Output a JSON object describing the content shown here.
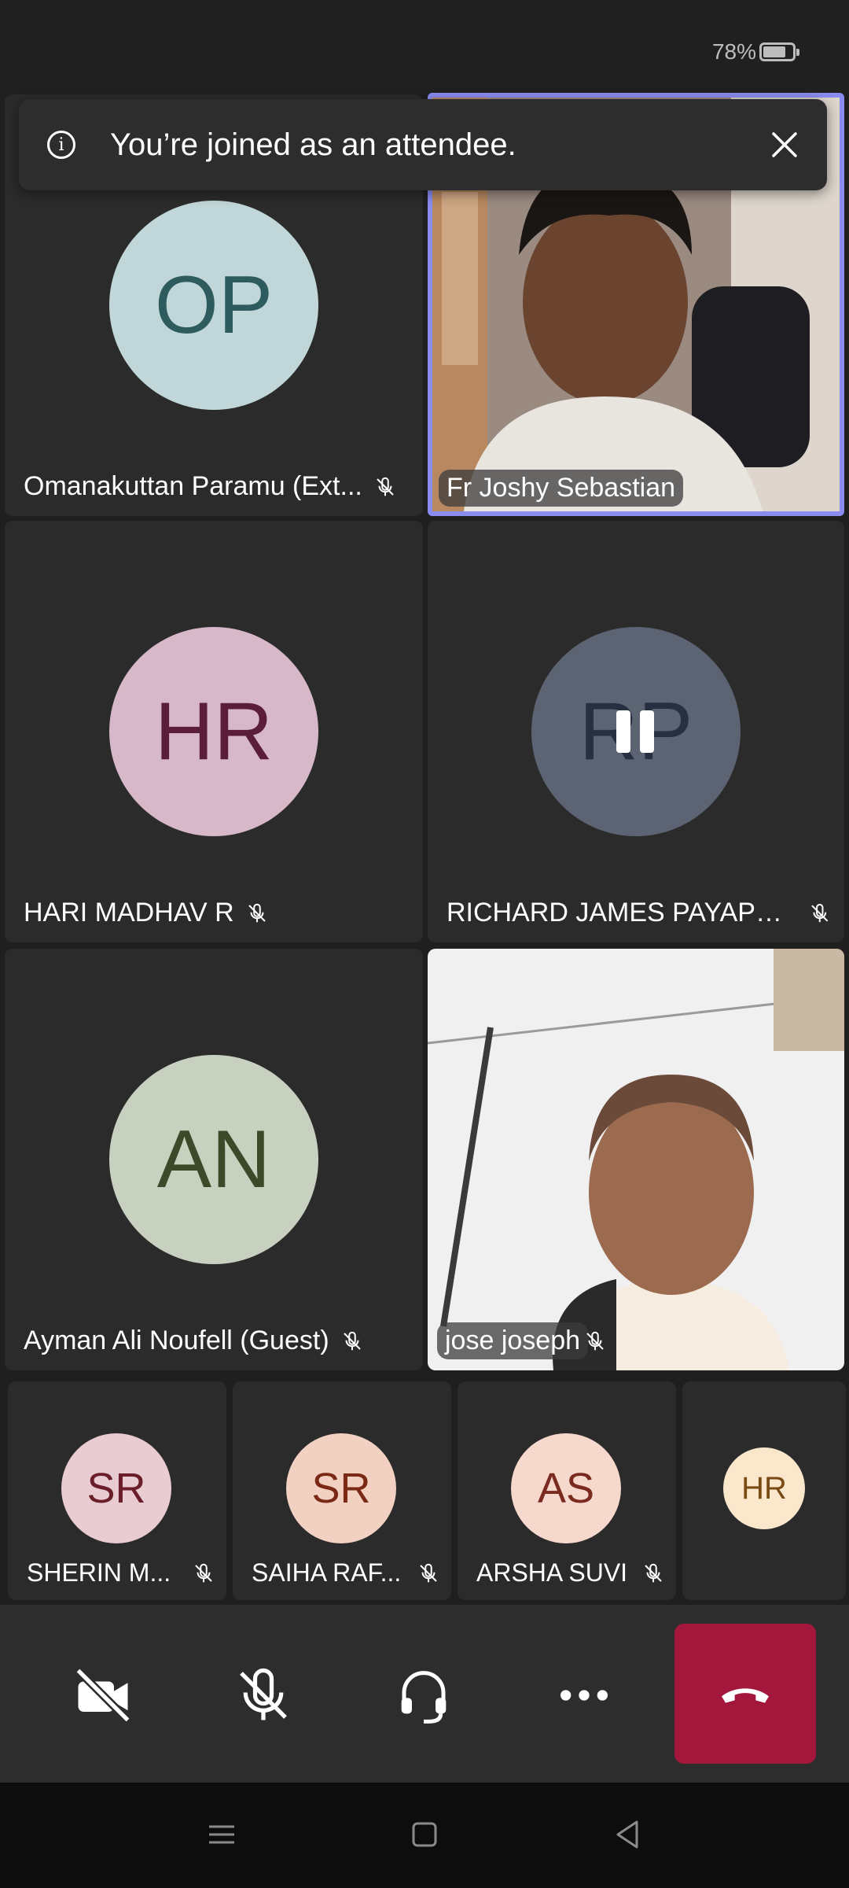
{
  "status_bar": {
    "battery_text": "78%",
    "battery_level": 0.78
  },
  "toast": {
    "text": "You’re joined as an attendee.",
    "info_icon": "i"
  },
  "participants": [
    {
      "name": "Omanakuttan Paramu (Ext...",
      "initials": "OP",
      "avatar_bg": "#c0d6d8",
      "avatar_fg": "#2e5c5e",
      "muted": true
    },
    {
      "name": "Fr Joshy Sebastian",
      "video": true,
      "active_speaker": true
    },
    {
      "name": "HARI MADHAV R",
      "initials": "HR",
      "avatar_bg": "#d6b8c8",
      "avatar_fg": "#5a1e3a",
      "muted": true
    },
    {
      "name": "RICHARD JAMES PAYAPPI...",
      "initials": "RP",
      "avatar_bg": "#5c6473",
      "avatar_fg": "#263040",
      "muted": true,
      "paused": true
    },
    {
      "name": "Ayman Ali Noufell (Guest)",
      "initials": "AN",
      "avatar_bg": "#c8d0c0",
      "avatar_fg": "#3c4a2a",
      "muted": true
    },
    {
      "name": "jose joseph",
      "video": true,
      "muted": true
    }
  ],
  "strip": [
    {
      "name": "SHERIN M...",
      "initials": "SR",
      "avatar_bg": "#e8ccd2",
      "avatar_fg": "#6a1e2a",
      "muted": true
    },
    {
      "name": "SAIHA RAF...",
      "initials": "SR",
      "avatar_bg": "#f2d0c2",
      "avatar_fg": "#7a2a14",
      "muted": true
    },
    {
      "name": "ARSHA SUVI",
      "initials": "AS",
      "avatar_bg": "#f6d8cc",
      "avatar_fg": "#7a2a1e",
      "muted": true
    },
    {
      "name": "",
      "initials": "HR",
      "avatar_bg": "#fbe8cc",
      "avatar_fg": "#7a4a14"
    }
  ],
  "colors": {
    "accent_border": "#8a8cf0",
    "hangup": "#a4173c"
  }
}
